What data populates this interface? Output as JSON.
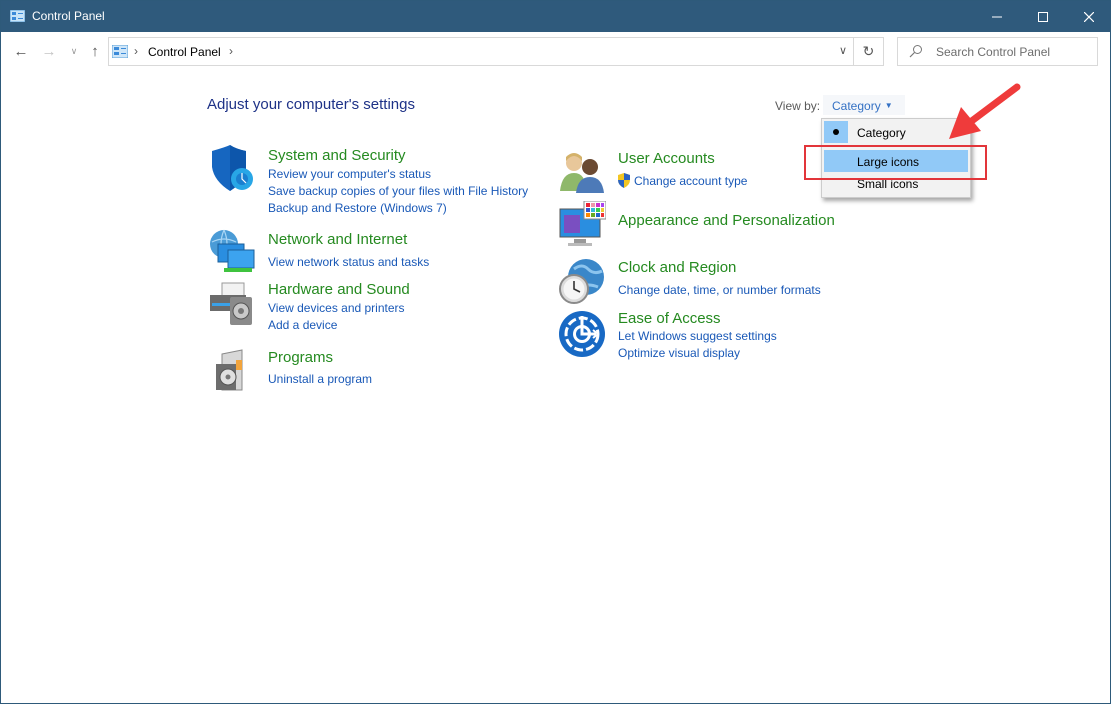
{
  "window": {
    "title": "Control Panel",
    "buttons": {
      "minimize": "minimize",
      "maximize": "maximize",
      "close": "close"
    }
  },
  "navigation": {
    "breadcrumb": [
      "Control Panel"
    ],
    "search_placeholder": "Search Control Panel"
  },
  "main": {
    "heading": "Adjust your computer's settings",
    "view_by": {
      "label": "View by:",
      "value": "Category",
      "options": [
        {
          "label": "Category",
          "checked": true,
          "hover": false
        },
        {
          "label": "Large icons",
          "checked": false,
          "hover": true
        },
        {
          "label": "Small icons",
          "checked": false,
          "hover": false
        }
      ]
    },
    "categories": [
      {
        "icon": "shield-icon",
        "title": "System and Security",
        "links": [
          "Review your computer's status",
          "Save backup copies of your files with File History",
          "Backup and Restore (Windows 7)"
        ]
      },
      {
        "icon": "network-icon",
        "title": "Network and Internet",
        "links": [
          "View network status and tasks"
        ]
      },
      {
        "icon": "printer-icon",
        "title": "Hardware and Sound",
        "links": [
          "View devices and printers",
          "Add a device"
        ]
      },
      {
        "icon": "programs-icon",
        "title": "Programs",
        "links": [
          "Uninstall a program"
        ]
      },
      {
        "icon": "users-icon",
        "title": "User Accounts",
        "links": [
          "Change account type"
        ]
      },
      {
        "icon": "monitor-palette-icon",
        "title": "Appearance and Personalization",
        "links": []
      },
      {
        "icon": "globe-clock-icon",
        "title": "Clock and Region",
        "links": [
          "Change date, time, or number formats"
        ]
      },
      {
        "icon": "ease-of-access-icon",
        "title": "Ease of Access",
        "links": [
          "Let Windows suggest settings",
          "Optimize visual display"
        ]
      }
    ]
  },
  "annotation": {
    "color": "#e2353a",
    "target": "Large icons"
  }
}
